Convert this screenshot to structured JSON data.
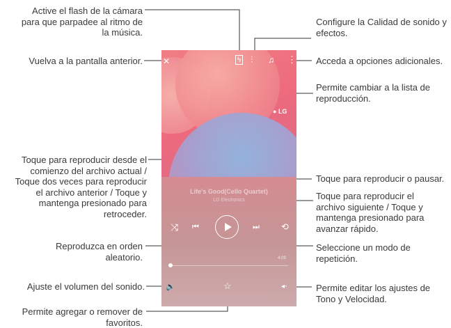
{
  "annotations": {
    "flash": "Active el flash de la cámara para que parpadee al ritmo de la música.",
    "back": "Vuelva a la pantalla anterior.",
    "prev": "Toque para reproducir desde el comienzo del archivo actual / Toque dos veces para reproducir el archivo anterior / Toque y mantenga presionado para retroceder.",
    "shuffle": "Reproduzca en orden aleatorio.",
    "volume": "Ajuste el volumen del sonido.",
    "favorite": "Permite agregar o remover de favoritos.",
    "sound_quality": "Configure la Calidad de sonido y efectos.",
    "more_options": "Acceda a opciones adicionales.",
    "playlist": "Permite cambiar a la lista de reproducción.",
    "play_pause": "Toque para reproducir o pausar.",
    "next": "Toque para reproducir el archivo siguiente / Toque y mantenga presionado para avanzar rápido.",
    "repeat": "Seleccione un modo de repetición.",
    "tone_speed": "Permite editar los ajustes de Tono y Velocidad."
  },
  "player": {
    "logo": "LG",
    "song_title": "Life's Good(Cello Quartet)",
    "artist": "LG Electronics",
    "total_time": "4:09",
    "current_time": "0:00",
    "playback_progress": 0
  },
  "icons": [
    "back-icon",
    "flash-icon",
    "equalizer-icon",
    "playlist-icon",
    "more-icon",
    "shuffle-icon",
    "previous-icon",
    "play-icon",
    "next-icon",
    "repeat-icon",
    "volume-icon",
    "favorite-icon",
    "tone-speed-icon"
  ]
}
